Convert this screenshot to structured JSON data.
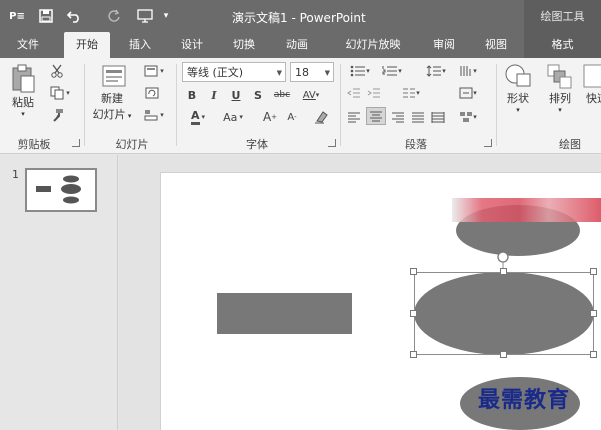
{
  "titlebar": {
    "app_badge": "P≡",
    "title": "演示文稿1 - PowerPoint",
    "context_title": "绘图工具"
  },
  "tabs": [
    {
      "label": "文件"
    },
    {
      "label": "开始"
    },
    {
      "label": "插入"
    },
    {
      "label": "设计"
    },
    {
      "label": "切换"
    },
    {
      "label": "动画"
    },
    {
      "label": "幻灯片放映"
    },
    {
      "label": "审阅"
    },
    {
      "label": "视图"
    },
    {
      "label": "格式"
    }
  ],
  "ribbon": {
    "clipboard": {
      "paste_label": "粘贴",
      "group_label": "剪贴板"
    },
    "slides": {
      "new_slide_label_1": "新建",
      "new_slide_label_2": "幻灯片",
      "group_label": "幻灯片"
    },
    "font": {
      "font_name": "等线 (正文)",
      "font_size": "18",
      "bold": "B",
      "italic": "I",
      "underline": "U",
      "shadow": "S",
      "strike": "abc",
      "spacing": "AV",
      "color": "A",
      "case": "Aa",
      "grow": "A",
      "shrink": "A",
      "group_label": "字体"
    },
    "paragraph": {
      "group_label": "段落"
    },
    "drawing": {
      "shapes_label": "形状",
      "arrange_label": "排列",
      "quick_label": "快速",
      "group_label": "绘图"
    }
  },
  "slides_pane": {
    "slide_number": "1"
  },
  "watermark": "最需教育"
}
